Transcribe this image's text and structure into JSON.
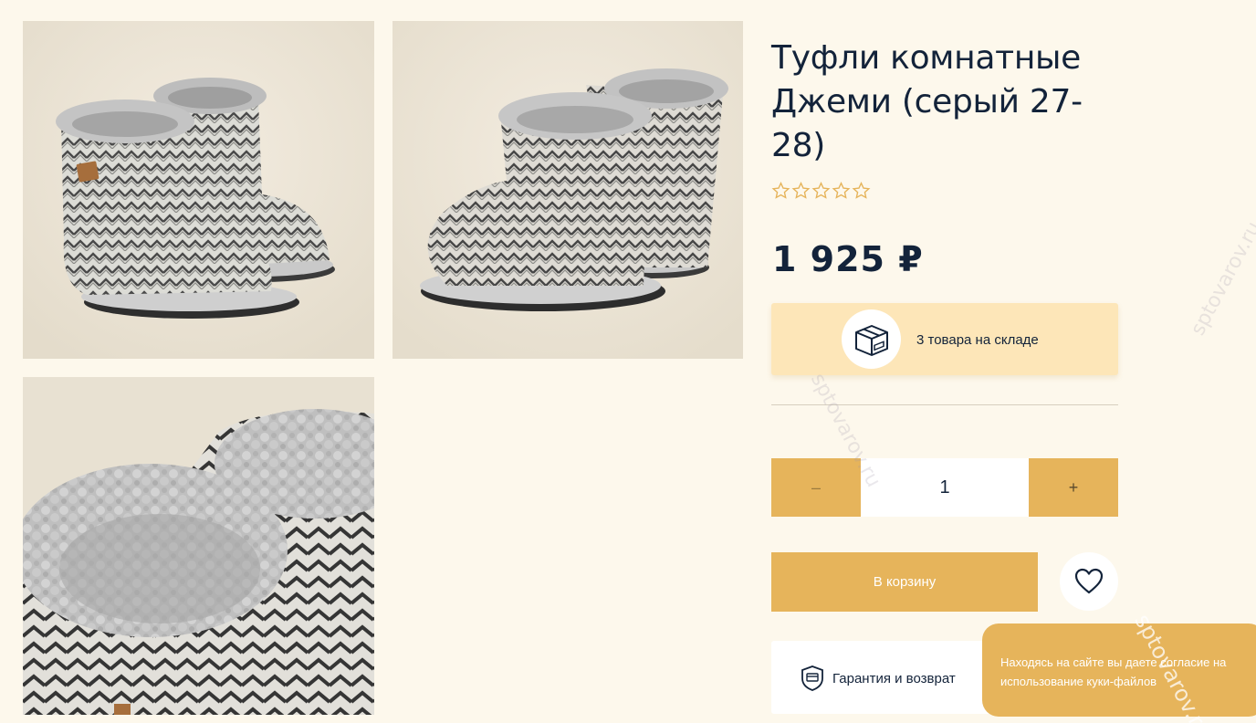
{
  "product": {
    "title": "Туфли комнатные Джеми (серый 27-28)",
    "rating": {
      "value": 0,
      "max": 5
    },
    "price": "1 925 ₽"
  },
  "stock": {
    "text": "3 товара на складе",
    "icon": "box-icon"
  },
  "quantity": {
    "minus_label": "–",
    "value": "1",
    "plus_label": "+"
  },
  "actions": {
    "cart_label": "В корзину",
    "favorite_icon": "heart-icon"
  },
  "guarantee": {
    "label": "Гарантия и возврат",
    "icon": "shield-card-icon"
  },
  "cookie": {
    "text": "Находясь на сайте вы даете согласие на использование куки-файлов"
  },
  "watermark": "sptovarov.ru",
  "colors": {
    "background": "#fdf8ec",
    "accent": "#e6b45b",
    "stock_bg": "#fde6b8",
    "text": "#13233a",
    "star": "#e6b45b"
  }
}
